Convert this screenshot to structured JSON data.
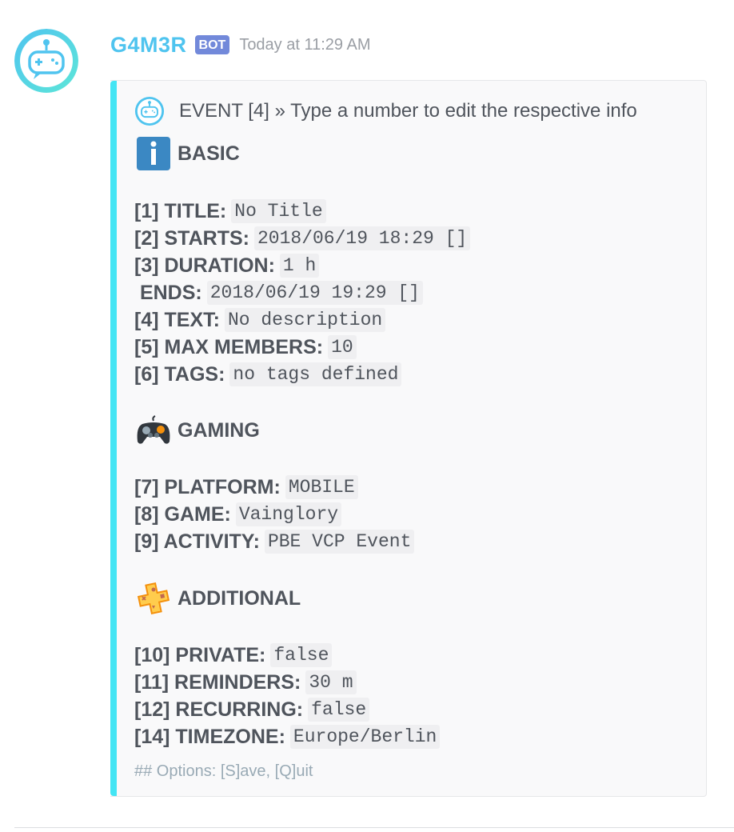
{
  "message": {
    "username": "G4M3R",
    "badge": "BOT",
    "timestamp": "Today at 11:29 AM",
    "avatar_icon": "robot-controller-icon",
    "accent_color": "#43e5f4",
    "username_color": "#4fc4ef"
  },
  "embed": {
    "author_icon": "robot-controller-icon",
    "author": "EVENT [4] » Type a number to edit the respective info",
    "sections": [
      {
        "icon": "info-icon",
        "title": "BASIC",
        "fields": [
          {
            "label": "[1] TITLE:",
            "value": "No Title"
          },
          {
            "label": "[2] STARTS:",
            "value": "2018/06/19 18:29 []"
          },
          {
            "label": "[3] DURATION:",
            "value": "1 h"
          },
          {
            "label": " ENDS:",
            "value": "2018/06/19 19:29 []"
          },
          {
            "label": "[4] TEXT:",
            "value": "No description"
          },
          {
            "label": "[5] MAX MEMBERS:",
            "value": "10"
          },
          {
            "label": "[6] TAGS:",
            "value": "no tags defined"
          }
        ]
      },
      {
        "icon": "game-controller-icon",
        "title": "GAMING",
        "fields": [
          {
            "label": "[7] PLATFORM:",
            "value": "MOBILE"
          },
          {
            "label": "[8] GAME:",
            "value": "Vainglory"
          },
          {
            "label": "[9] ACTIVITY:",
            "value": "PBE VCP Event"
          }
        ]
      },
      {
        "icon": "plus-sign-icon",
        "title": "ADDITIONAL",
        "fields": [
          {
            "label": "[10] PRIVATE:",
            "value": "false"
          },
          {
            "label": "[11] REMINDERS:",
            "value": "30 m"
          },
          {
            "label": "[12] RECURRING:",
            "value": "false"
          },
          {
            "label": "[14] TIMEZONE:",
            "value": "Europe/Berlin"
          }
        ]
      }
    ],
    "footer": "## Options: [S]ave, [Q]uit"
  }
}
